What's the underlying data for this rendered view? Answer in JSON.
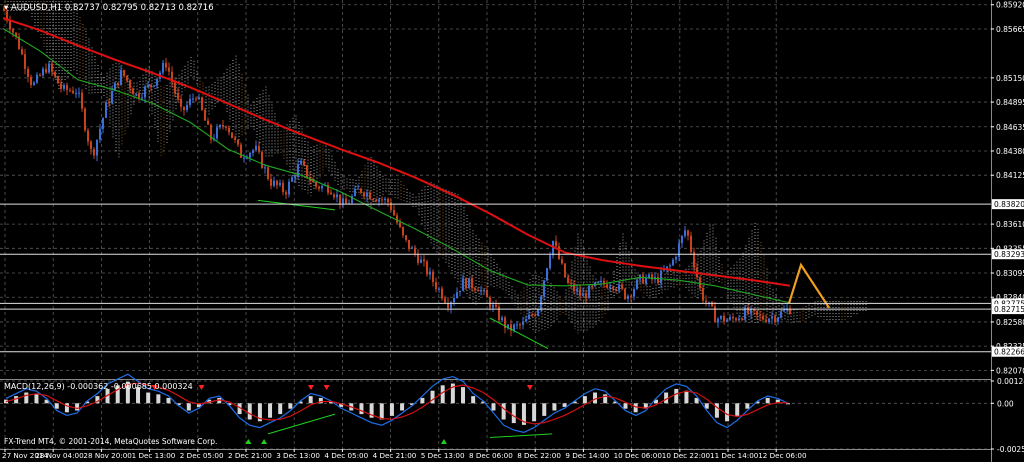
{
  "colors": {
    "background": "#000000",
    "grid": "#5a5a5a",
    "axis_text": "#ffffff",
    "bull": "#3b6fd6",
    "bear": "#c8431c",
    "ma_slow": "#e01010",
    "ma_mid": "#1fa81f",
    "cloud": "#d9d9d9",
    "cloud_orange": "#c07a2c",
    "forecast": "#f0a020",
    "macd_hist": "#d8d8d8",
    "macd_main": "#1f6fe8",
    "macd_signal": "#d01010",
    "divergence": "#1fd11f"
  },
  "main_header": {
    "symbol": "AUDUSD,H1",
    "ohlc": "0.82737 0.82795 0.82713 0.82716"
  },
  "macd_header": "MACD(12,26,9) -0.000362 -0.000685 0.000324",
  "copyright": "FX-Trend MT4, © 2001-2014, MetaQuotes Software Corp.",
  "chart_data": [
    {
      "type": "candlestick",
      "title": "AUDUSD,H1",
      "ylim": [
        0.82,
        0.8597
      ],
      "y_tick_labels": [
        "0.85920",
        "0.85665",
        "0.85150",
        "0.84895",
        "0.84635",
        "0.84380",
        "0.84125",
        "0.83610",
        "0.83355",
        "0.83095",
        "0.82840",
        "0.82580",
        "0.82325",
        "0.82070"
      ],
      "y_tick_values": [
        0.8592,
        0.85665,
        0.8515,
        0.84895,
        0.84635,
        0.8438,
        0.84125,
        0.8361,
        0.83355,
        0.83095,
        0.8284,
        0.8258,
        0.82325,
        0.8207
      ],
      "x_tick_labels": [
        "27 Nov 2014",
        "28 Nov 04:00",
        "28 Nov 20:00",
        "1 Dec 13:00",
        "2 Dec 05:00",
        "2 Dec 21:00",
        "3 Dec 13:00",
        "4 Dec 05:00",
        "4 Dec 21:00",
        "5 Dec 13:00",
        "8 Dec 06:00",
        "8 Dec 22:00",
        "9 Dec 14:00",
        "10 Dec 06:00",
        "10 Dec 22:00",
        "11 Dec 14:00",
        "12 Dec 06:00"
      ],
      "horizontal_levels": [
        {
          "value": 0.8382,
          "label": "0.83820"
        },
        {
          "value": 0.83293,
          "label": "0.83293"
        },
        {
          "value": 0.82775,
          "label": "0.82775"
        },
        {
          "value": 0.82715,
          "label": "0.82715"
        },
        {
          "value": 0.82266,
          "label": "0.82266"
        }
      ],
      "price_path": [
        0.8588,
        0.8552,
        0.8506,
        0.8528,
        0.8502,
        0.8502,
        0.8432,
        0.8488,
        0.8521,
        0.8496,
        0.8508,
        0.8531,
        0.8478,
        0.8498,
        0.8451,
        0.8468,
        0.8434,
        0.844,
        0.8406,
        0.8395,
        0.8425,
        0.8401,
        0.84,
        0.838,
        0.8398,
        0.839,
        0.8384,
        0.8344,
        0.8325,
        0.83,
        0.8278,
        0.83,
        0.8295,
        0.8273,
        0.825,
        0.8255,
        0.8272,
        0.8345,
        0.8298,
        0.8285,
        0.8296,
        0.83,
        0.8285,
        0.8304,
        0.8302,
        0.8318,
        0.8357,
        0.8288,
        0.8262,
        0.826,
        0.8268,
        0.8262,
        0.8264,
        0.8272
      ],
      "ma_slow": [
        0.8578,
        0.8565,
        0.8549,
        0.8534,
        0.852,
        0.8505,
        0.8488,
        0.8471,
        0.8455,
        0.844,
        0.8426,
        0.841,
        0.8392,
        0.8372,
        0.835,
        0.8331,
        0.8323,
        0.8317,
        0.8312,
        0.8307,
        0.8302,
        0.8296
      ],
      "ma_mid": [
        0.8567,
        0.8543,
        0.8513,
        0.8502,
        0.8488,
        0.8468,
        0.844,
        0.8423,
        0.8412,
        0.8395,
        0.8375,
        0.8356,
        0.8335,
        0.8312,
        0.8297,
        0.8296,
        0.8298,
        0.8305,
        0.8302,
        0.8296,
        0.8287,
        0.8278
      ],
      "forecast": [
        0.82775,
        0.8318,
        0.8273
      ],
      "series_note": ""
    },
    {
      "type": "macd",
      "title": "MACD(12,26,9)",
      "y_tick_labels": [
        "0.00124",
        "0.00",
        "-0.00254"
      ],
      "y_tick_values": [
        0.00124,
        0.0,
        -0.00254
      ],
      "histogram": [
        0.0002,
        0.0004,
        0.0006,
        0.0005,
        0.0002,
        -0.0003,
        -0.0005,
        -0.0004,
        0.0001,
        0.0004,
        0.0008,
        0.001,
        0.0012,
        0.0009,
        0.0006,
        0.0005,
        0.0003,
        -0.0001,
        -0.0004,
        -0.0002,
        0.0002,
        0.0003,
        -0.0001,
        -0.0006,
        -0.0009,
        -0.001,
        -0.0008,
        -0.0006,
        -0.0003,
        0.0001,
        0.0004,
        0.0003,
        0.0001,
        -0.0002,
        -0.0004,
        -0.0006,
        -0.0008,
        -0.0009,
        -0.0007,
        -0.0004,
        -0.0001,
        0.0003,
        0.0007,
        0.001,
        0.0011,
        0.0009,
        0.0004,
        0.0001,
        -0.0004,
        -0.0009,
        -0.0011,
        -0.0012,
        -0.001,
        -0.0007,
        -0.0004,
        -0.0002,
        0.0001,
        0.0004,
        0.0006,
        0.0005,
        0.0001,
        -0.0003,
        -0.0005,
        -0.0003,
        0.0002,
        0.0006,
        0.0008,
        0.0007,
        0.0003,
        -0.0003,
        -0.0008,
        -0.001,
        -0.0007,
        -0.0003,
        0.0001,
        0.0003,
        0.0002,
        0.0
      ],
      "signal_markers": [
        {
          "at": 0.19,
          "dir": "down"
        },
        {
          "at": 0.25,
          "dir": "down"
        },
        {
          "at": 0.39,
          "dir": "down"
        },
        {
          "at": 0.41,
          "dir": "down"
        },
        {
          "at": 0.31,
          "dir": "up"
        },
        {
          "at": 0.33,
          "dir": "up"
        },
        {
          "at": 0.67,
          "dir": "down"
        },
        {
          "at": 0.56,
          "dir": "up"
        }
      ]
    }
  ]
}
